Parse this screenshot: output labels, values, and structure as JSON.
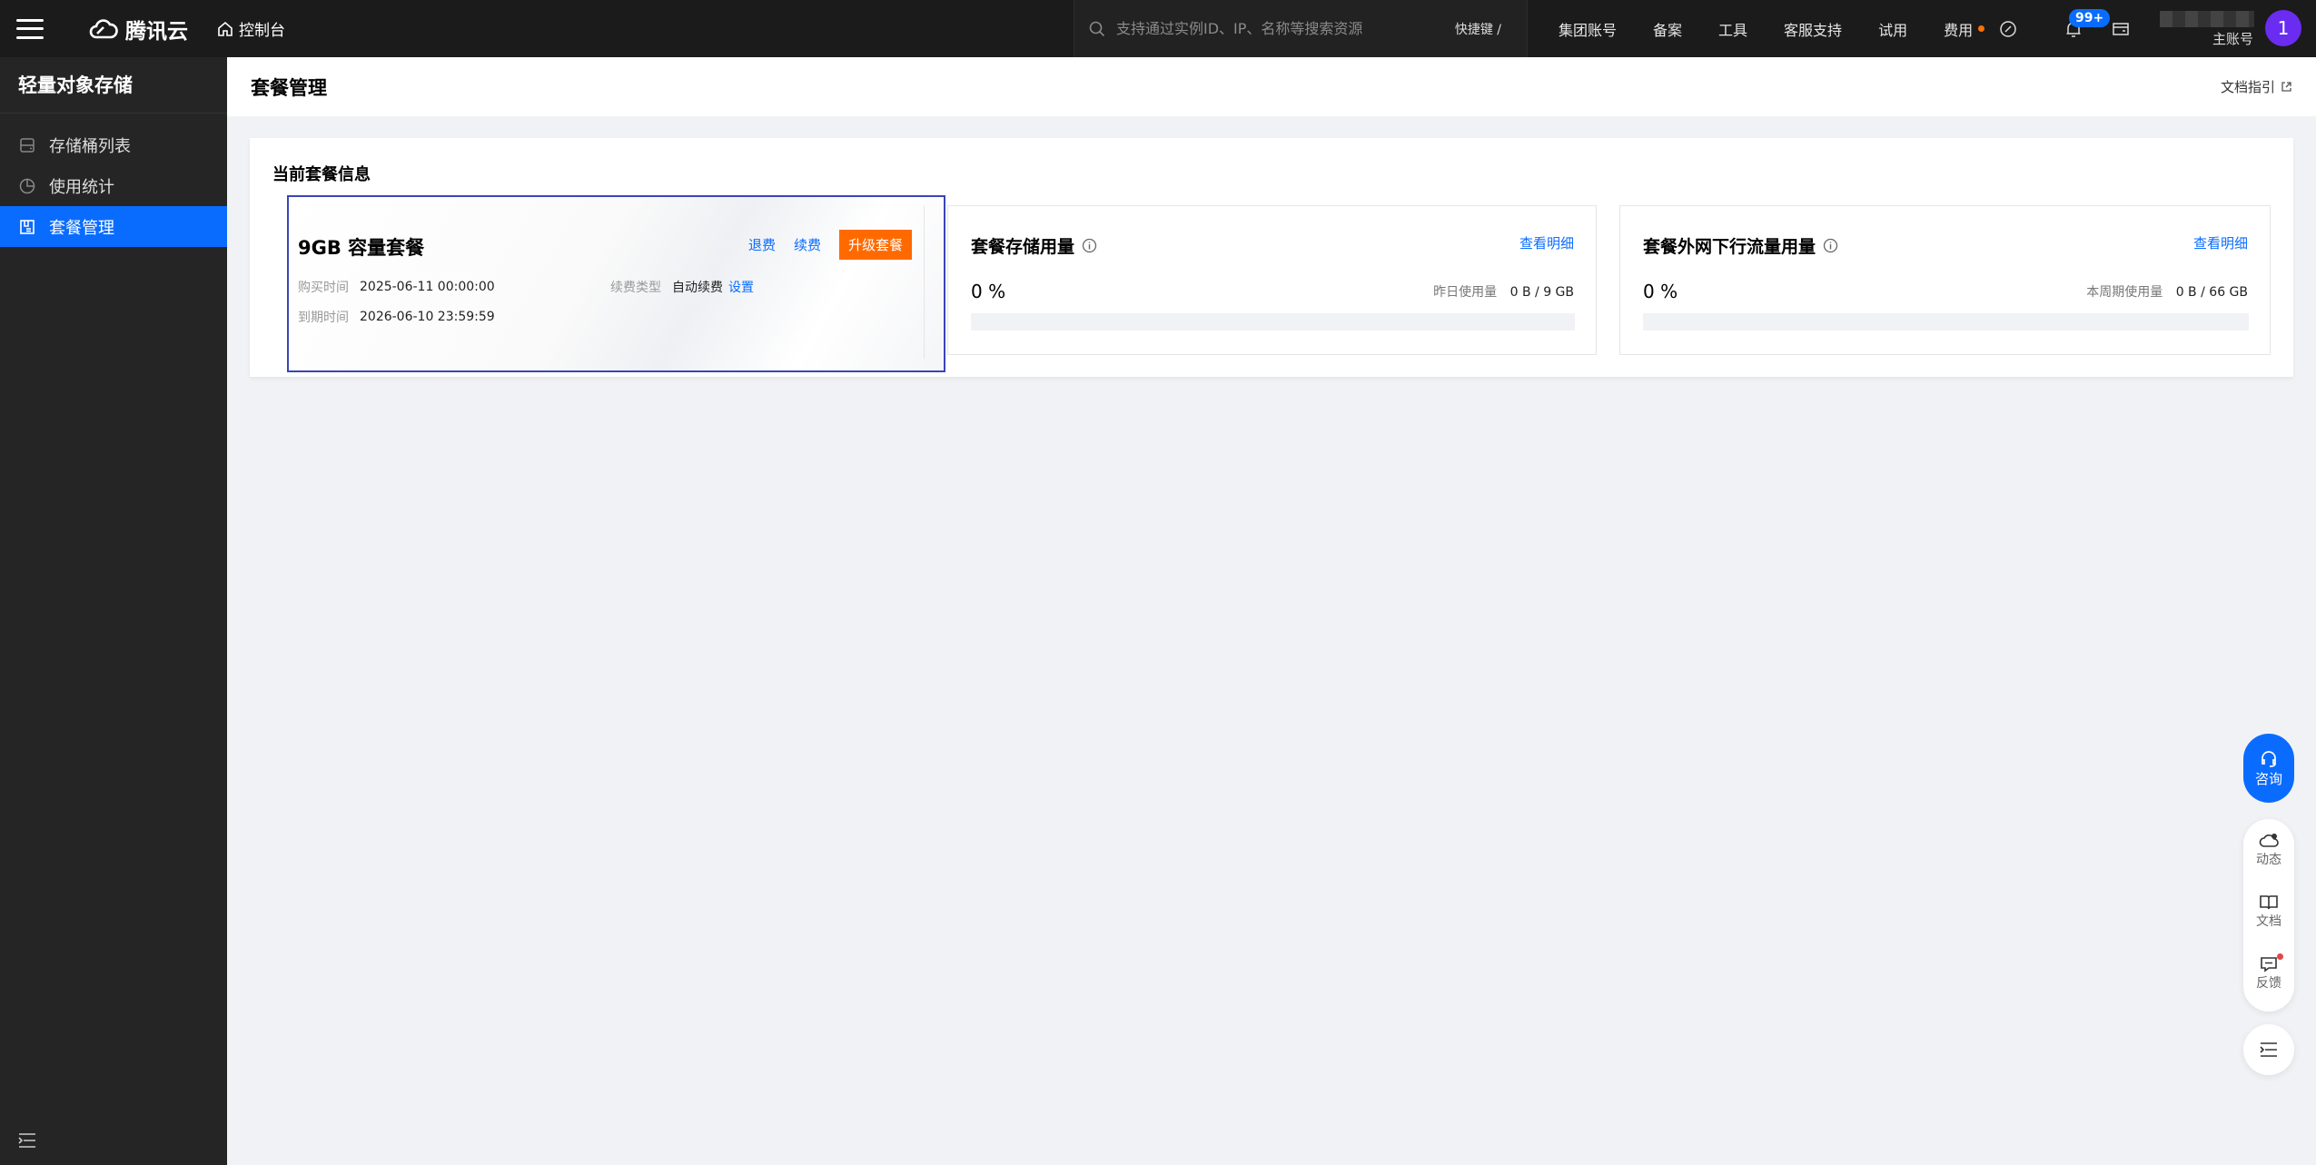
{
  "topbar": {
    "brand": "腾讯云",
    "console": "控制台",
    "search_placeholder": "支持通过实例ID、IP、名称等搜索资源",
    "shortcut": "快捷键 /",
    "nav": [
      "集团账号",
      "备案",
      "工具",
      "客服支持",
      "试用",
      "费用"
    ],
    "notification_badge": "99+",
    "account_label": "主账号",
    "avatar_letter": "1"
  },
  "sidebar": {
    "title": "轻量对象存储",
    "items": [
      {
        "label": "存储桶列表",
        "icon": "bucket-icon"
      },
      {
        "label": "使用统计",
        "icon": "pie-icon"
      },
      {
        "label": "套餐管理",
        "icon": "package-icon",
        "active": true
      }
    ]
  },
  "header": {
    "title": "套餐管理",
    "doc_link": "文档指引"
  },
  "current": {
    "title": "当前套餐信息",
    "package": {
      "name": "9GB 容量套餐",
      "refund": "退费",
      "renew": "续费",
      "upgrade": "升级套餐",
      "purchase_label": "购买时间",
      "purchase_time": "2025-06-11 00:00:00",
      "renew_type_label": "续费类型",
      "renew_type": "自动续费",
      "set": "设置",
      "expire_label": "到期时间",
      "expire_time": "2026-06-10 23:59:59"
    },
    "storage": {
      "title": "套餐存储用量",
      "detail": "查看明细",
      "percent": "0 %",
      "used_label": "昨日使用量",
      "used_value": "0 B / 9 GB",
      "progress": 0
    },
    "traffic": {
      "title": "套餐外网下行流量用量",
      "detail": "查看明细",
      "percent": "0 %",
      "used_label": "本周期使用量",
      "used_value": "0 B / 66 GB",
      "progress": 0
    }
  },
  "float": {
    "consult": "咨询",
    "tools": [
      "动态",
      "文档",
      "反馈"
    ]
  },
  "colors": {
    "accent": "#0a6cff",
    "upgrade": "#ff6a00",
    "topbar": "#1b1b1b",
    "sidebar": "#252525"
  }
}
